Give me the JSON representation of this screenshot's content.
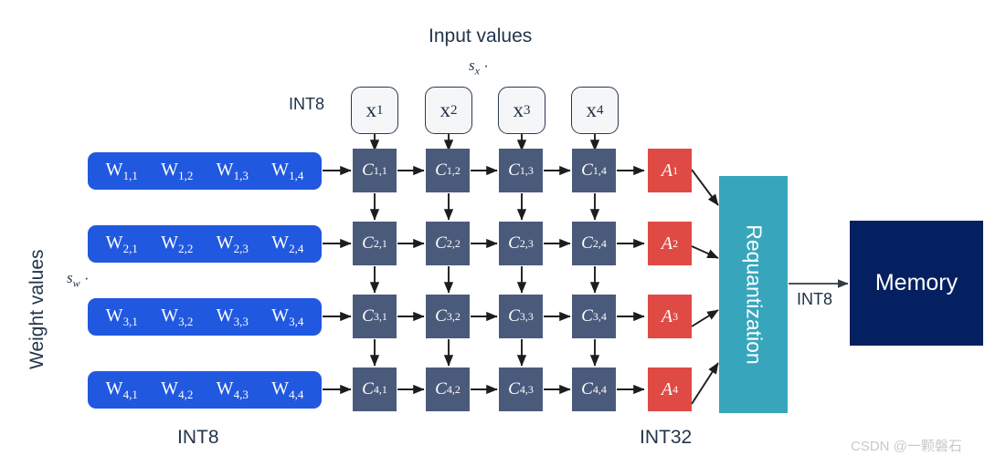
{
  "diagram": {
    "input_section": {
      "title": "Input values",
      "scale": {
        "symbol": "s",
        "subscript": "x",
        "operator": "·"
      },
      "dtype_label": "INT8",
      "inputs": [
        {
          "base": "x",
          "sub": "1"
        },
        {
          "base": "x",
          "sub": "2"
        },
        {
          "base": "x",
          "sub": "3"
        },
        {
          "base": "x",
          "sub": "4"
        }
      ]
    },
    "weight_section": {
      "title": "Weight values",
      "scale": {
        "symbol": "s",
        "subscript": "w",
        "operator": "·"
      },
      "dtype_label": "INT8",
      "rows": [
        [
          {
            "base": "W",
            "sub": "1,1"
          },
          {
            "base": "W",
            "sub": "1,2"
          },
          {
            "base": "W",
            "sub": "1,3"
          },
          {
            "base": "W",
            "sub": "1,4"
          }
        ],
        [
          {
            "base": "W",
            "sub": "2,1"
          },
          {
            "base": "W",
            "sub": "2,2"
          },
          {
            "base": "W",
            "sub": "2,3"
          },
          {
            "base": "W",
            "sub": "2,4"
          }
        ],
        [
          {
            "base": "W",
            "sub": "3,1"
          },
          {
            "base": "W",
            "sub": "3,2"
          },
          {
            "base": "W",
            "sub": "3,3"
          },
          {
            "base": "W",
            "sub": "3,4"
          }
        ],
        [
          {
            "base": "W",
            "sub": "4,1"
          },
          {
            "base": "W",
            "sub": "4,2"
          },
          {
            "base": "W",
            "sub": "4,3"
          },
          {
            "base": "W",
            "sub": "4,4"
          }
        ]
      ]
    },
    "array_section": {
      "cells": [
        [
          {
            "base": "C",
            "sub": "1,1"
          },
          {
            "base": "C",
            "sub": "1,2"
          },
          {
            "base": "C",
            "sub": "1,3"
          },
          {
            "base": "C",
            "sub": "1,4"
          }
        ],
        [
          {
            "base": "C",
            "sub": "2,1"
          },
          {
            "base": "C",
            "sub": "2,2"
          },
          {
            "base": "C",
            "sub": "2,3"
          },
          {
            "base": "C",
            "sub": "2,4"
          }
        ],
        [
          {
            "base": "C",
            "sub": "3,1"
          },
          {
            "base": "C",
            "sub": "3,2"
          },
          {
            "base": "C",
            "sub": "3,3"
          },
          {
            "base": "C",
            "sub": "3,4"
          }
        ],
        [
          {
            "base": "C",
            "sub": "4,1"
          },
          {
            "base": "C",
            "sub": "4,2"
          },
          {
            "base": "C",
            "sub": "4,3"
          },
          {
            "base": "C",
            "sub": "4,4"
          }
        ]
      ]
    },
    "accumulator_section": {
      "dtype_label": "INT32",
      "cells": [
        {
          "base": "A",
          "sub": "1"
        },
        {
          "base": "A",
          "sub": "2"
        },
        {
          "base": "A",
          "sub": "3"
        },
        {
          "base": "A",
          "sub": "4"
        }
      ]
    },
    "requantization": {
      "label": "Requantization"
    },
    "output": {
      "dtype_label": "INT8",
      "memory_label": "Memory"
    },
    "watermark": "CSDN @一颗磐石",
    "colors": {
      "weight_blue": "#2158e0",
      "cell_slate": "#4a5a7b",
      "accumulator_red": "#df4a44",
      "requant_teal": "#37a6bc",
      "memory_navy": "#042060",
      "text_dark": "#24354b",
      "arrow": "#1d1d1d"
    }
  }
}
